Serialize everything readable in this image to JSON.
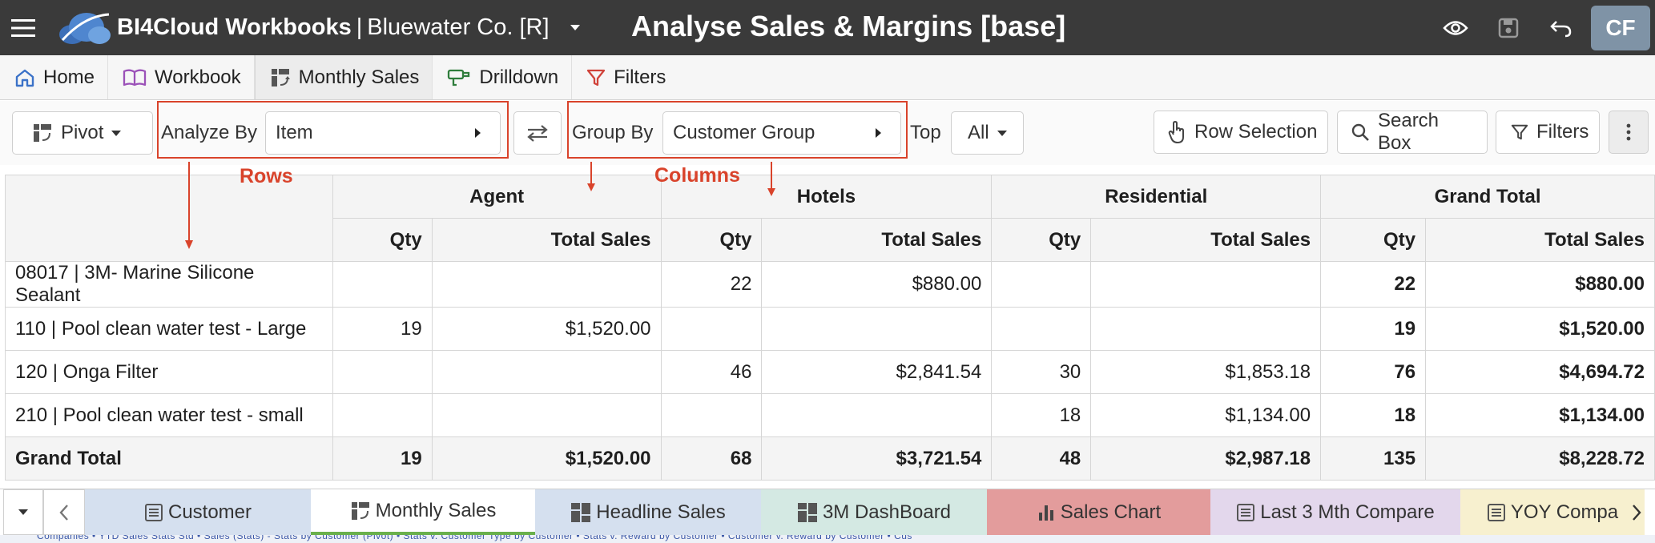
{
  "app": {
    "brand": "BI4Cloud Workbooks",
    "separator": "|",
    "company": "Bluewater Co. [R]",
    "page_title": "Analyse Sales & Margins [base]",
    "avatar_initials": "CF"
  },
  "nav": {
    "tabs": [
      {
        "label": "Home",
        "icon": "home-icon"
      },
      {
        "label": "Workbook",
        "icon": "book-icon"
      },
      {
        "label": "Monthly Sales",
        "icon": "pivot-icon",
        "active": true
      },
      {
        "label": "Drilldown",
        "icon": "drilldown-icon"
      },
      {
        "label": "Filters",
        "icon": "filter-icon"
      }
    ]
  },
  "toolbar": {
    "pivot_label": "Pivot",
    "analyze_by_label": "Analyze By",
    "analyze_by_value": "Item",
    "group_by_label": "Group By",
    "group_by_value": "Customer Group",
    "top_label": "Top",
    "top_value": "All",
    "row_selection_label": "Row Selection",
    "search_box_label": "Search Box",
    "filters_label": "Filters"
  },
  "annotations": {
    "rows": "Rows",
    "columns": "Columns",
    "color": "#d9432b"
  },
  "table": {
    "groups": [
      "Agent",
      "Hotels",
      "Residential",
      "Grand Total"
    ],
    "subcols": {
      "qty": "Qty",
      "sales": "Total Sales"
    },
    "rows": [
      {
        "label": "08017 | 3M- Marine Silicone Sealant",
        "cells": [
          "",
          "",
          "22",
          "$880.00",
          "",
          "",
          "22",
          "$880.00"
        ]
      },
      {
        "label": "110 | Pool clean water test - Large",
        "cells": [
          "19",
          "$1,520.00",
          "",
          "",
          "",
          "",
          "19",
          "$1,520.00"
        ]
      },
      {
        "label": "120 | Onga Filter",
        "cells": [
          "",
          "",
          "46",
          "$2,841.54",
          "30",
          "$1,853.18",
          "76",
          "$4,694.72"
        ]
      },
      {
        "label": "210 | Pool clean water test - small",
        "cells": [
          "",
          "",
          "",
          "",
          "18",
          "$1,134.00",
          "18",
          "$1,134.00"
        ]
      }
    ],
    "total": {
      "label": "Grand Total",
      "cells": [
        "19",
        "$1,520.00",
        "68",
        "$3,721.54",
        "48",
        "$2,987.18",
        "135",
        "$8,228.72"
      ]
    }
  },
  "sheets": [
    {
      "label": "Customer",
      "color": "#d5e0ef",
      "icon": "list-icon"
    },
    {
      "label": "Monthly Sales",
      "color": "#ffffff",
      "icon": "pivot-icon",
      "active": true
    },
    {
      "label": "Headline Sales",
      "color": "#d5e0ef",
      "icon": "dashboard-icon"
    },
    {
      "label": "3M DashBoard",
      "color": "#d4e9e3",
      "icon": "dashboard-icon"
    },
    {
      "label": "Sales Chart",
      "color": "#e39c9c",
      "icon": "bar-chart-icon"
    },
    {
      "label": "Last 3 Mth Compare",
      "color": "#e3d7ec",
      "icon": "list-icon"
    },
    {
      "label": "YOY Compa",
      "color": "#f7f0cf",
      "icon": "list-icon"
    }
  ],
  "footer_text": "Companies  •  YTD Sales Stats Std  •  Sales (Stats) - Stats by Customer (Pivot)  •  Stats v. Customer Type by Customer  •  Stats v. Reward by Customer  •  Customer v. Reward by Customer  •  Cus"
}
